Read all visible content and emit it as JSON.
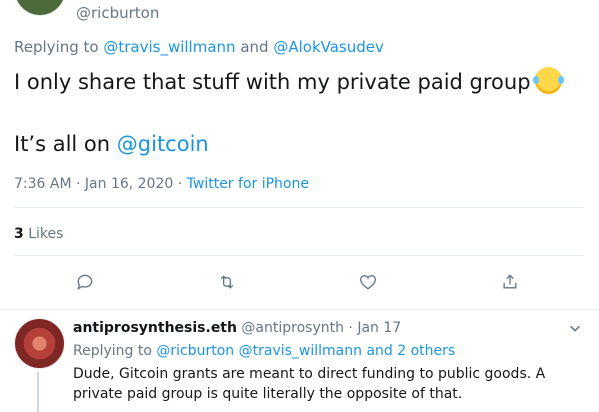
{
  "tweet": {
    "handle": "@ricburton",
    "replying_prefix": "Replying to",
    "replying_mention_1": "@travis_willmann",
    "replying_and": "and",
    "replying_mention_2": "@AlokVasudev",
    "text_line1": "I only share that stuff with my private paid group",
    "emoji": "face-with-tears-of-joy",
    "text_line2_prefix": "It’s all on",
    "text_line2_mention": "@gitcoin",
    "time": "7:36 AM",
    "date": "Jan 16, 2020",
    "separator": "·",
    "source": "Twitter for iPhone",
    "likes_count": "3",
    "likes_label": "Likes"
  },
  "actions": {
    "icons": [
      "reply-icon",
      "retweet-icon",
      "like-icon",
      "share-icon"
    ]
  },
  "reply": {
    "name": "antiprosynthesis.eth",
    "handle": "@antiprosynth",
    "separator": "·",
    "date": "Jan 17",
    "replying_prefix": "Replying to",
    "mentions": "@ricburton @travis_willmann and 2 others",
    "text": "Dude, Gitcoin grants are meant to direct funding to public goods. A private paid group is quite literally the opposite of that."
  },
  "colors": {
    "link": "#1b95e0",
    "muted": "#657786",
    "text": "#14171a",
    "divider": "#e6ecf0"
  }
}
